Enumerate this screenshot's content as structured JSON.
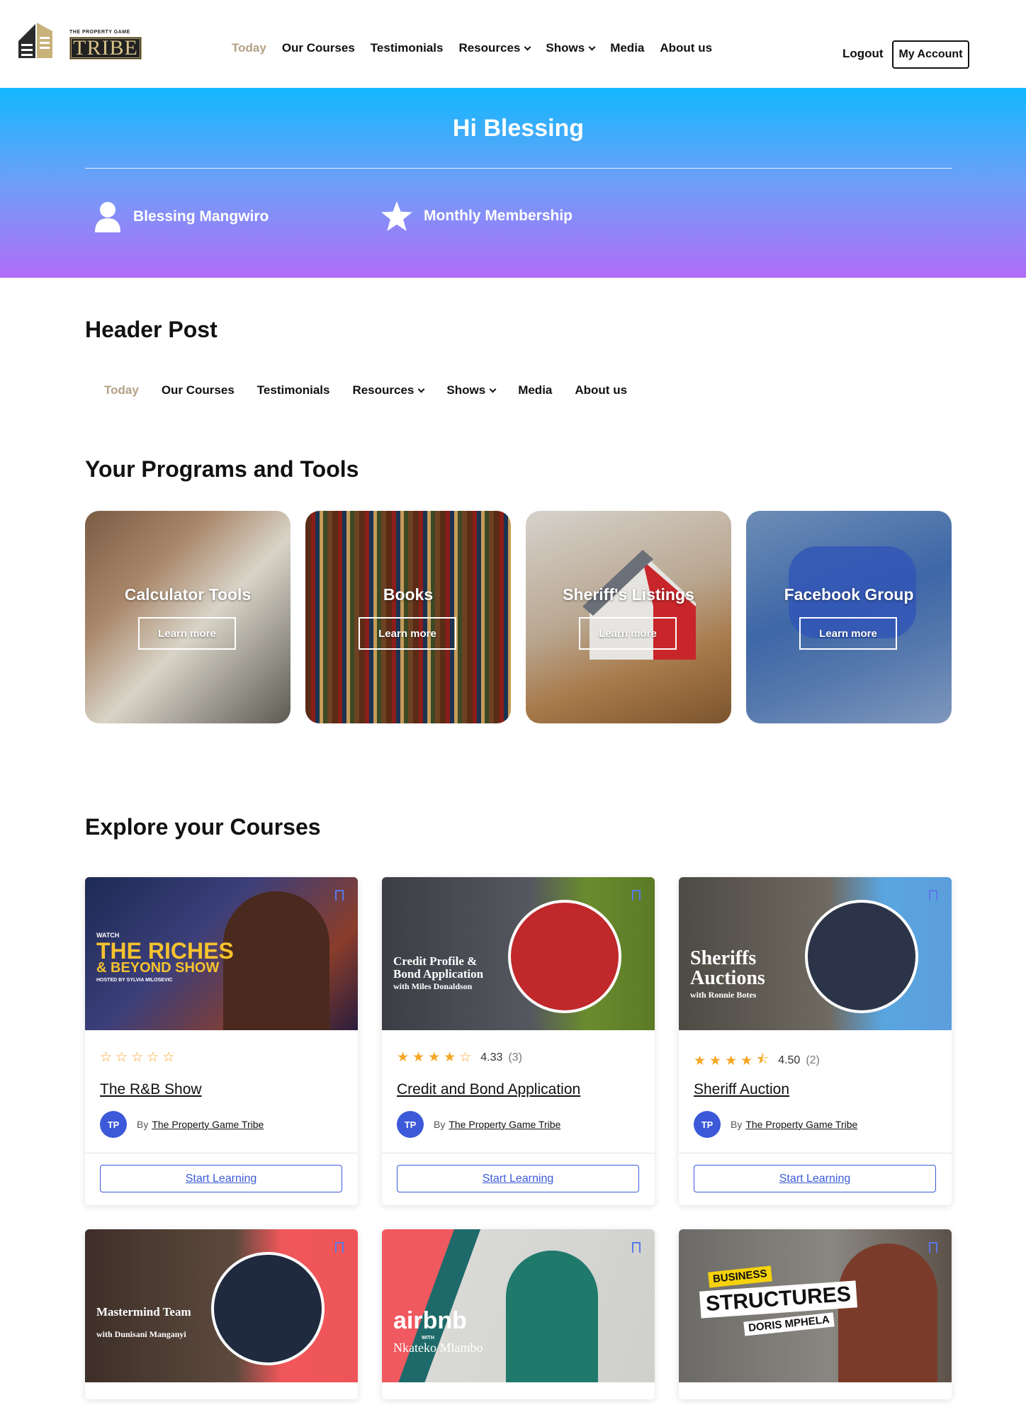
{
  "brand": {
    "tagline": "THE PROPERTY GAME",
    "wordmark": "TRIBE"
  },
  "nav": {
    "items": [
      {
        "label": "Today",
        "active": true
      },
      {
        "label": "Our Courses"
      },
      {
        "label": "Testimonials"
      },
      {
        "label": "Resources",
        "dropdown": true
      },
      {
        "label": "Shows",
        "dropdown": true
      },
      {
        "label": "Media"
      },
      {
        "label": "About us"
      }
    ],
    "logout": "Logout",
    "my_account": "My Account"
  },
  "hero": {
    "greeting": "Hi Blessing",
    "user_name": "Blessing Mangwiro",
    "plan": "Monthly Membership"
  },
  "header_post": {
    "title": "Header Post"
  },
  "programs": {
    "title": "Your Programs and Tools",
    "tiles": [
      {
        "title": "Calculator Tools",
        "button": "Learn more"
      },
      {
        "title": "Books",
        "button": "Learn more"
      },
      {
        "title": "Sheriff's Listings",
        "button": "Learn more"
      },
      {
        "title": "Facebook Group",
        "button": "Learn more"
      }
    ]
  },
  "courses": {
    "title": "Explore your Courses",
    "by_label": "By",
    "author": "The Property Game Tribe",
    "author_initials": "TP",
    "cta": "Start Learning",
    "items": [
      {
        "title": "The R&B Show",
        "rating": 0,
        "score": "",
        "count": "",
        "thumb_text": [
          "WATCH",
          "THE RICHES",
          "& BEYOND SHOW",
          "HOSTED BY SYLVIA MILOSEVIC"
        ]
      },
      {
        "title": "Credit and Bond Application",
        "rating": 4.33,
        "score": "4.33",
        "count": "(3)",
        "thumb_text": [
          "Credit Profile &",
          "Bond Application",
          "with Miles Donaldson"
        ]
      },
      {
        "title": "Sheriff Auction",
        "rating": 4.5,
        "score": "4.50",
        "count": "(2)",
        "thumb_text": [
          "Sheriffs",
          "Auctions",
          "with Ronnie Botes"
        ]
      },
      {
        "thumb_text": [
          "Mastermind Team",
          "with Dunisani Manganyi"
        ]
      },
      {
        "thumb_text": [
          "airbnb",
          "WITH",
          "Nkateko Mlambo"
        ]
      },
      {
        "thumb_text": [
          "BUSINESS",
          "STRUCTURES",
          "DORIS MPHELA"
        ]
      }
    ]
  },
  "colors": {
    "accent": "#3b59d8",
    "gold": "#b5a185",
    "star": "#f5a623",
    "hero_top": "#12b8fd",
    "hero_bottom": "#b16cf7"
  }
}
